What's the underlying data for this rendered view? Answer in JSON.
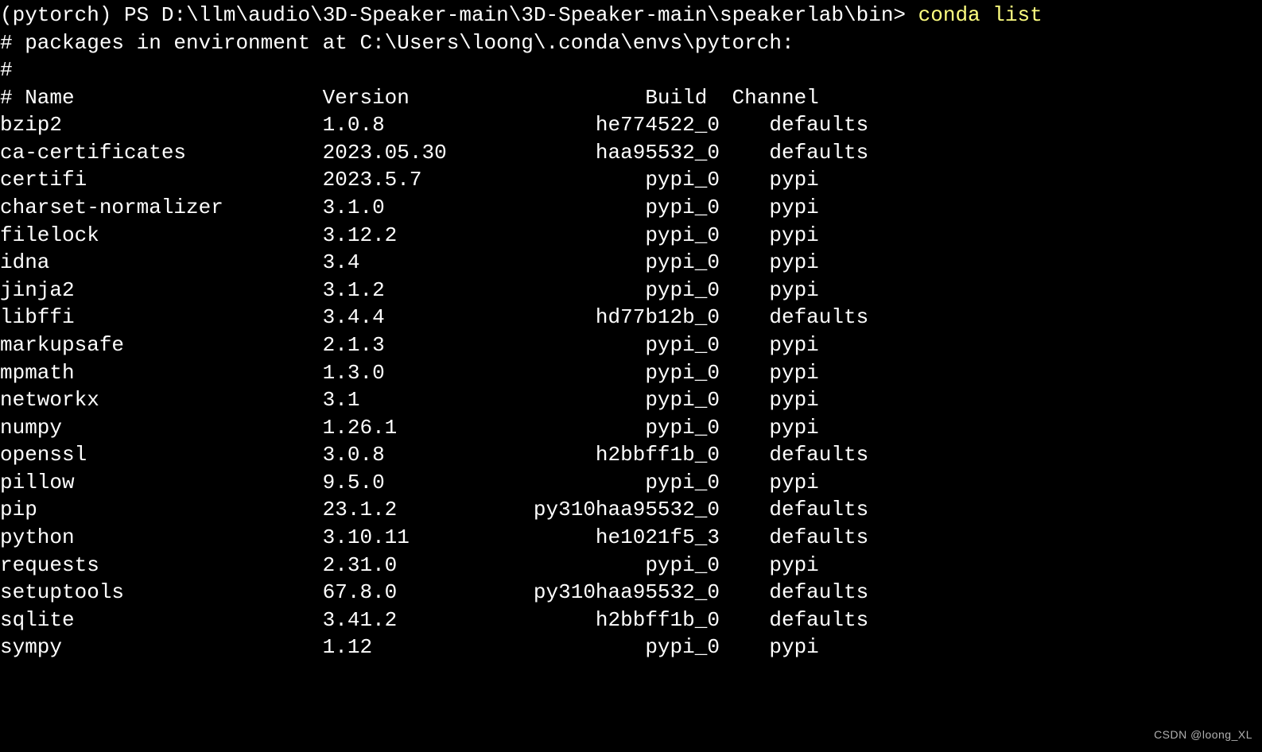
{
  "prompt": {
    "env": "(pytorch)",
    "shell": "PS",
    "path": "D:\\llm\\audio\\3D-Speaker-main\\3D-Speaker-main\\speakerlab\\bin>",
    "command": "conda list"
  },
  "header": {
    "line1": "# packages in environment at C:\\Users\\loong\\.conda\\envs\\pytorch:",
    "line2": "#",
    "cols": "# Name                    Version                   Build  Channel"
  },
  "packages": [
    {
      "name": "bzip2",
      "version": "1.0.8",
      "build": "he774522_0",
      "channel": "defaults"
    },
    {
      "name": "ca-certificates",
      "version": "2023.05.30",
      "build": "haa95532_0",
      "channel": "defaults"
    },
    {
      "name": "certifi",
      "version": "2023.5.7",
      "build": "pypi_0",
      "channel": "pypi"
    },
    {
      "name": "charset-normalizer",
      "version": "3.1.0",
      "build": "pypi_0",
      "channel": "pypi"
    },
    {
      "name": "filelock",
      "version": "3.12.2",
      "build": "pypi_0",
      "channel": "pypi"
    },
    {
      "name": "idna",
      "version": "3.4",
      "build": "pypi_0",
      "channel": "pypi"
    },
    {
      "name": "jinja2",
      "version": "3.1.2",
      "build": "pypi_0",
      "channel": "pypi"
    },
    {
      "name": "libffi",
      "version": "3.4.4",
      "build": "hd77b12b_0",
      "channel": "defaults"
    },
    {
      "name": "markupsafe",
      "version": "2.1.3",
      "build": "pypi_0",
      "channel": "pypi"
    },
    {
      "name": "mpmath",
      "version": "1.3.0",
      "build": "pypi_0",
      "channel": "pypi"
    },
    {
      "name": "networkx",
      "version": "3.1",
      "build": "pypi_0",
      "channel": "pypi"
    },
    {
      "name": "numpy",
      "version": "1.26.1",
      "build": "pypi_0",
      "channel": "pypi"
    },
    {
      "name": "openssl",
      "version": "3.0.8",
      "build": "h2bbff1b_0",
      "channel": "defaults"
    },
    {
      "name": "pillow",
      "version": "9.5.0",
      "build": "pypi_0",
      "channel": "pypi"
    },
    {
      "name": "pip",
      "version": "23.1.2",
      "build": "py310haa95532_0",
      "channel": "defaults"
    },
    {
      "name": "python",
      "version": "3.10.11",
      "build": "he1021f5_3",
      "channel": "defaults"
    },
    {
      "name": "requests",
      "version": "2.31.0",
      "build": "pypi_0",
      "channel": "pypi"
    },
    {
      "name": "setuptools",
      "version": "67.8.0",
      "build": "py310haa95532_0",
      "channel": "defaults"
    },
    {
      "name": "sqlite",
      "version": "3.41.2",
      "build": "h2bbff1b_0",
      "channel": "defaults"
    },
    {
      "name": "sympy",
      "version": "1.12",
      "build": "pypi_0",
      "channel": "pypi"
    }
  ],
  "watermark": "CSDN @loong_XL"
}
